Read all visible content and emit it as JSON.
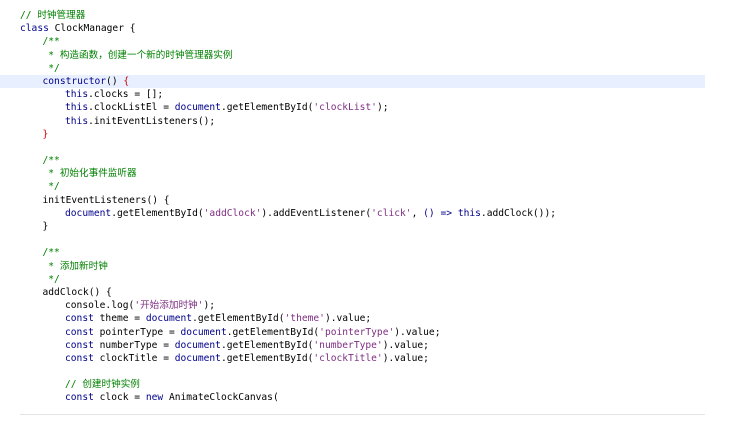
{
  "editor": {
    "lines": [
      {
        "indent": 0,
        "tokens": [
          {
            "t": "// 时钟管理器",
            "c": "cm"
          }
        ]
      },
      {
        "indent": 0,
        "tokens": [
          {
            "t": "class ",
            "c": "kw"
          },
          {
            "t": "ClockManager ",
            "c": "pl"
          },
          {
            "t": "{",
            "c": "pl"
          }
        ]
      },
      {
        "indent": 1,
        "tokens": [
          {
            "t": "/**",
            "c": "cm"
          }
        ]
      },
      {
        "indent": 1,
        "tokens": [
          {
            "t": " * 构造函数，创建一个新的时钟管理器实例",
            "c": "cm"
          }
        ]
      },
      {
        "indent": 1,
        "tokens": [
          {
            "t": " */",
            "c": "cm"
          }
        ]
      },
      {
        "indent": 1,
        "current": true,
        "tokens": [
          {
            "t": "constructor",
            "c": "kw"
          },
          {
            "t": "() ",
            "c": "pl"
          },
          {
            "t": "{",
            "c": "red"
          }
        ]
      },
      {
        "indent": 2,
        "tokens": [
          {
            "t": "this",
            "c": "kw"
          },
          {
            "t": ".clocks = [];",
            "c": "pl"
          }
        ]
      },
      {
        "indent": 2,
        "tokens": [
          {
            "t": "this",
            "c": "kw"
          },
          {
            "t": ".clockListEl = ",
            "c": "pl"
          },
          {
            "t": "document",
            "c": "kw"
          },
          {
            "t": ".getElementById(",
            "c": "pl"
          },
          {
            "t": "'clockList'",
            "c": "str"
          },
          {
            "t": ");",
            "c": "pl"
          }
        ]
      },
      {
        "indent": 2,
        "tokens": [
          {
            "t": "this",
            "c": "kw"
          },
          {
            "t": ".initEventListeners();",
            "c": "pl"
          }
        ]
      },
      {
        "indent": 1,
        "tokens": [
          {
            "t": "}",
            "c": "red"
          }
        ]
      },
      {
        "indent": 0,
        "tokens": []
      },
      {
        "indent": 1,
        "tokens": [
          {
            "t": "/**",
            "c": "cm"
          }
        ]
      },
      {
        "indent": 1,
        "tokens": [
          {
            "t": " * 初始化事件监听器",
            "c": "cm"
          }
        ]
      },
      {
        "indent": 1,
        "tokens": [
          {
            "t": " */",
            "c": "cm"
          }
        ]
      },
      {
        "indent": 1,
        "tokens": [
          {
            "t": "initEventListeners() {",
            "c": "pl"
          }
        ]
      },
      {
        "indent": 2,
        "tokens": [
          {
            "t": "document",
            "c": "kw"
          },
          {
            "t": ".getElementById(",
            "c": "pl"
          },
          {
            "t": "'addClock'",
            "c": "str"
          },
          {
            "t": ").addEventListener(",
            "c": "pl"
          },
          {
            "t": "'click'",
            "c": "str"
          },
          {
            "t": ", ",
            "c": "pl"
          },
          {
            "t": "() => ",
            "c": "kw"
          },
          {
            "t": "this",
            "c": "kw"
          },
          {
            "t": ".addClock());",
            "c": "pl"
          }
        ]
      },
      {
        "indent": 1,
        "tokens": [
          {
            "t": "}",
            "c": "pl"
          }
        ]
      },
      {
        "indent": 0,
        "tokens": []
      },
      {
        "indent": 1,
        "tokens": [
          {
            "t": "/**",
            "c": "cm"
          }
        ]
      },
      {
        "indent": 1,
        "tokens": [
          {
            "t": " * 添加新时钟",
            "c": "cm"
          }
        ]
      },
      {
        "indent": 1,
        "tokens": [
          {
            "t": " */",
            "c": "cm"
          }
        ]
      },
      {
        "indent": 1,
        "tokens": [
          {
            "t": "addClock() {",
            "c": "pl"
          }
        ]
      },
      {
        "indent": 2,
        "tokens": [
          {
            "t": "console.log(",
            "c": "pl"
          },
          {
            "t": "'开始添加时钟'",
            "c": "str"
          },
          {
            "t": ");",
            "c": "pl"
          }
        ]
      },
      {
        "indent": 2,
        "tokens": [
          {
            "t": "const ",
            "c": "kw"
          },
          {
            "t": "theme = ",
            "c": "pl"
          },
          {
            "t": "document",
            "c": "kw"
          },
          {
            "t": ".getElementById(",
            "c": "pl"
          },
          {
            "t": "'theme'",
            "c": "str"
          },
          {
            "t": ").value;",
            "c": "pl"
          }
        ]
      },
      {
        "indent": 2,
        "tokens": [
          {
            "t": "const ",
            "c": "kw"
          },
          {
            "t": "pointerType = ",
            "c": "pl"
          },
          {
            "t": "document",
            "c": "kw"
          },
          {
            "t": ".getElementById(",
            "c": "pl"
          },
          {
            "t": "'pointerType'",
            "c": "str"
          },
          {
            "t": ").value;",
            "c": "pl"
          }
        ]
      },
      {
        "indent": 2,
        "tokens": [
          {
            "t": "const ",
            "c": "kw"
          },
          {
            "t": "numberType = ",
            "c": "pl"
          },
          {
            "t": "document",
            "c": "kw"
          },
          {
            "t": ".getElementById(",
            "c": "pl"
          },
          {
            "t": "'numberType'",
            "c": "str"
          },
          {
            "t": ").value;",
            "c": "pl"
          }
        ]
      },
      {
        "indent": 2,
        "tokens": [
          {
            "t": "const ",
            "c": "kw"
          },
          {
            "t": "clockTitle = ",
            "c": "pl"
          },
          {
            "t": "document",
            "c": "kw"
          },
          {
            "t": ".getElementById(",
            "c": "pl"
          },
          {
            "t": "'clockTitle'",
            "c": "str"
          },
          {
            "t": ").value;",
            "c": "pl"
          }
        ]
      },
      {
        "indent": 0,
        "tokens": []
      },
      {
        "indent": 2,
        "tokens": [
          {
            "t": "// 创建时钟实例",
            "c": "cm"
          }
        ]
      },
      {
        "indent": 2,
        "tokens": [
          {
            "t": "const ",
            "c": "kw"
          },
          {
            "t": "clock = ",
            "c": "pl"
          },
          {
            "t": "new ",
            "c": "kw"
          },
          {
            "t": "AnimateClockCanvas(",
            "c": "pl"
          }
        ]
      }
    ]
  },
  "colors": {
    "keyword": "#00008b",
    "comment": "#008000",
    "string": "#7e2e82",
    "brace_match": "#cc0000",
    "current_line": "#e8f0ff",
    "background": "#ffffff"
  }
}
